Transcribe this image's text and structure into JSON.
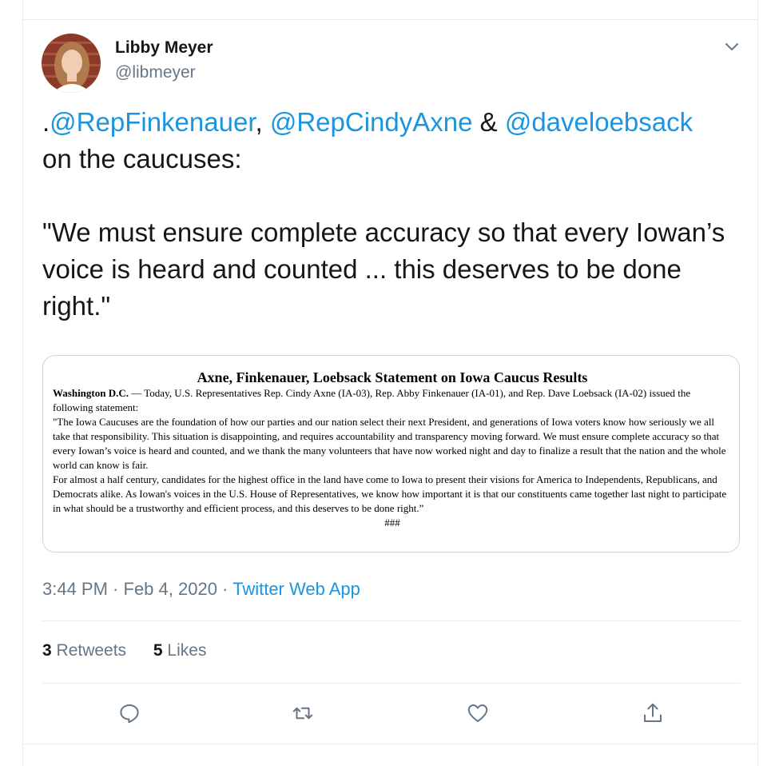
{
  "author": {
    "name": "Libby Meyer",
    "handle": "@libmeyer"
  },
  "tweet": {
    "prefix": ".",
    "mention1": "@RepFinkenauer",
    "comma": ", ",
    "mention2": "@RepCindyAxne",
    "amp": " & ",
    "mention3": "@daveloebsack",
    "line2": " on the caucuses:",
    "quote": "\"We must ensure complete accuracy so that every Iowan’s voice is heard and counted ... this deserves to be done right.\""
  },
  "media": {
    "title": "Axne, Finkenauer, Loebsack Statement on Iowa Caucus Results",
    "dateline": "Washington D.C.",
    "intro": " — Today, U.S. Representatives Rep. Cindy Axne (IA-03), Rep. Abby Finkenauer (IA-01), and Rep. Dave Loebsack (IA-02) issued the following statement:",
    "para1": "\"The Iowa Caucuses are the foundation of how our parties and our nation select their next President, and generations of Iowa voters know how seriously we all take that responsibility. This situation is disappointing, and requires accountability and transparency moving forward. We must ensure complete accuracy so that every Iowan’s voice is heard and counted, and we thank the many volunteers that have now worked night and day to finalize a result that the nation and the whole world can know is fair.",
    "para2": "For almost a half century, candidates for the highest office in the land have come to Iowa to present their visions for America to Independents, Republicans, and Democrats alike. As Iowan's voices in the U.S. House of Representatives, we know how important it is that our constituents came together last night to participate in what should be a trustworthy and efficient process, and this deserves to be done right.”",
    "end": "###"
  },
  "meta": {
    "time": "3:44 PM",
    "dot1": " · ",
    "date": "Feb 4, 2020",
    "dot2": " · ",
    "source": "Twitter Web App"
  },
  "stats": {
    "retweets_count": "3",
    "retweets_label": " Retweets",
    "likes_count": "5",
    "likes_label": " Likes"
  },
  "icons": {
    "menu": "chevron-down-icon",
    "reply": "reply-icon",
    "retweet": "retweet-icon",
    "like": "heart-icon",
    "share": "share-icon"
  },
  "colors": {
    "link": "#1b95e0",
    "secondary": "#657786",
    "border": "#e6ecf0"
  }
}
